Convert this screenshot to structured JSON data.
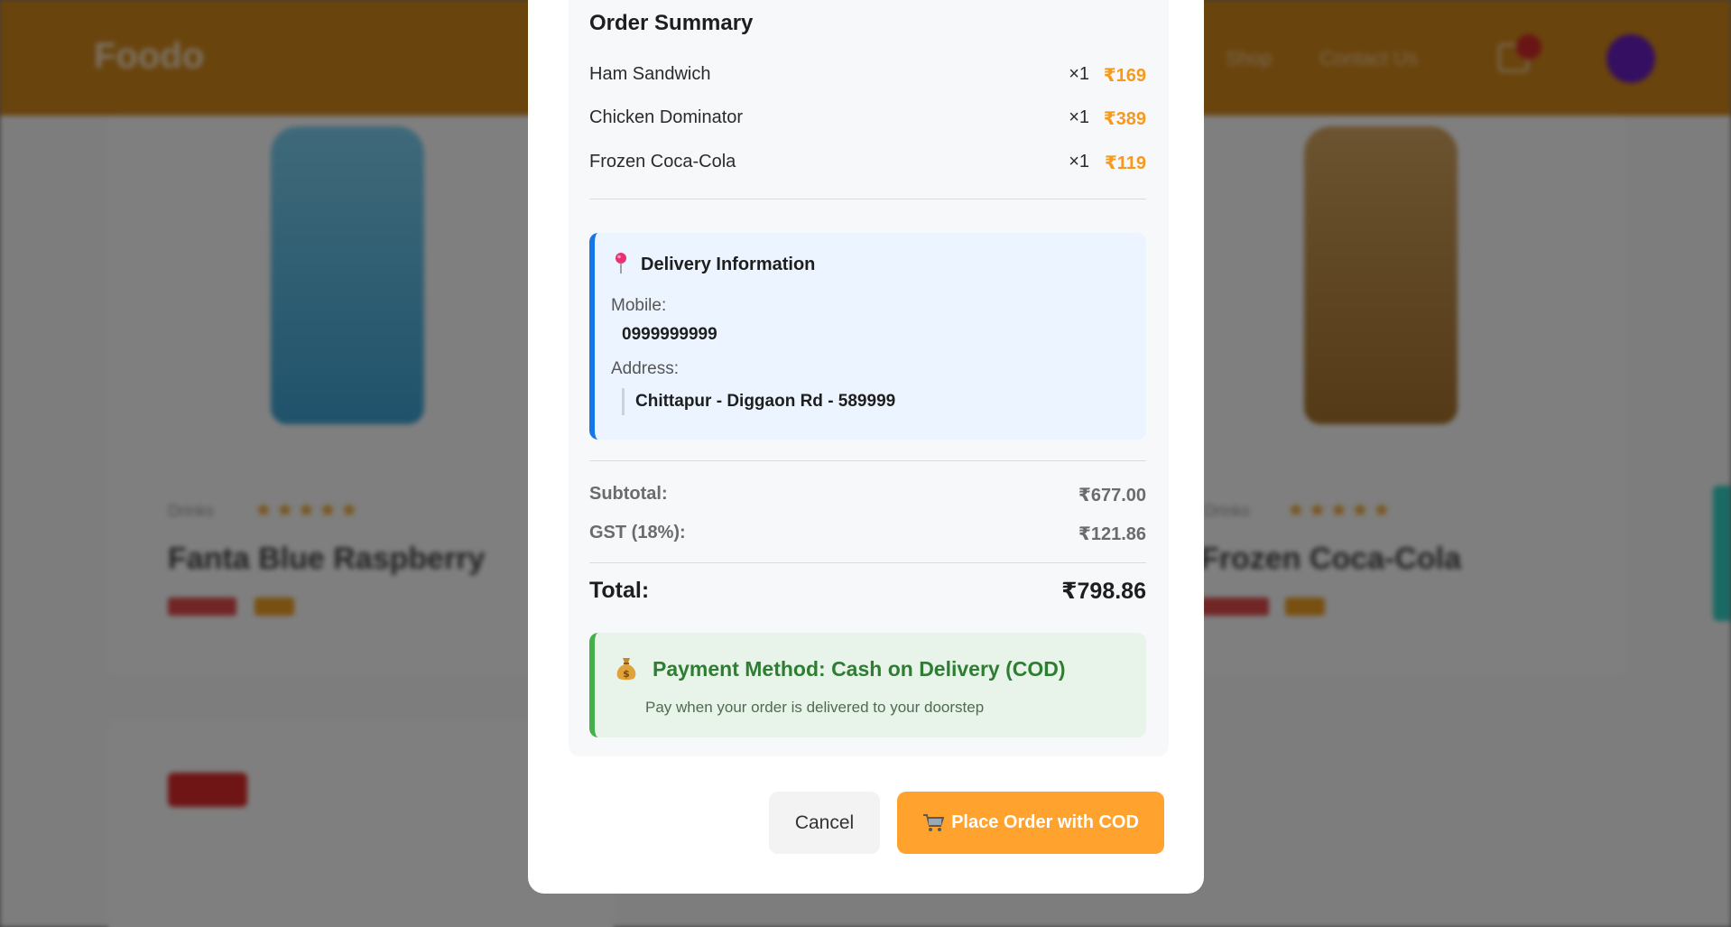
{
  "background": {
    "logo": "Foodo",
    "nav": [
      "Shop",
      "Contact Us"
    ],
    "products": [
      {
        "category": "Drinks",
        "name": "Fanta Blue Raspberry"
      },
      {
        "category": "Drinks",
        "name": "Frozen Coca-Cola"
      }
    ],
    "stars": "★★★★★"
  },
  "modal": {
    "summary_title": "Order Summary",
    "items": [
      {
        "name": "Ham Sandwich",
        "qty": "×1",
        "price": "₹169"
      },
      {
        "name": "Chicken Dominator",
        "qty": "×1",
        "price": "₹389"
      },
      {
        "name": "Frozen Coca-Cola",
        "qty": "×1",
        "price": "₹119"
      }
    ],
    "delivery": {
      "title": "Delivery Information",
      "mobile_label": "Mobile:",
      "mobile": "0999999999",
      "address_label": "Address:",
      "address": "Chittapur - Diggaon Rd - 589999"
    },
    "totals": {
      "subtotal_label": "Subtotal:",
      "subtotal": "₹677.00",
      "gst_label": "GST (18%):",
      "gst": "₹121.86",
      "total_label": "Total:",
      "total": "₹798.86"
    },
    "payment": {
      "title": "Payment Method: Cash on Delivery (COD)",
      "subtitle": "Pay when your order is delivered to your doorstep"
    },
    "buttons": {
      "cancel": "Cancel",
      "place_order": "Place Order with COD"
    }
  },
  "colors": {
    "accent": "#ffa22e",
    "price": "#f59a1e",
    "delivery_border": "#1676e8",
    "payment_border": "#44b04c",
    "payment_text": "#2e7d32",
    "header": "#d4881a"
  },
  "icons": {
    "delivery": "map-pin-icon",
    "payment": "money-bag-icon",
    "place_order": "cart-icon"
  }
}
